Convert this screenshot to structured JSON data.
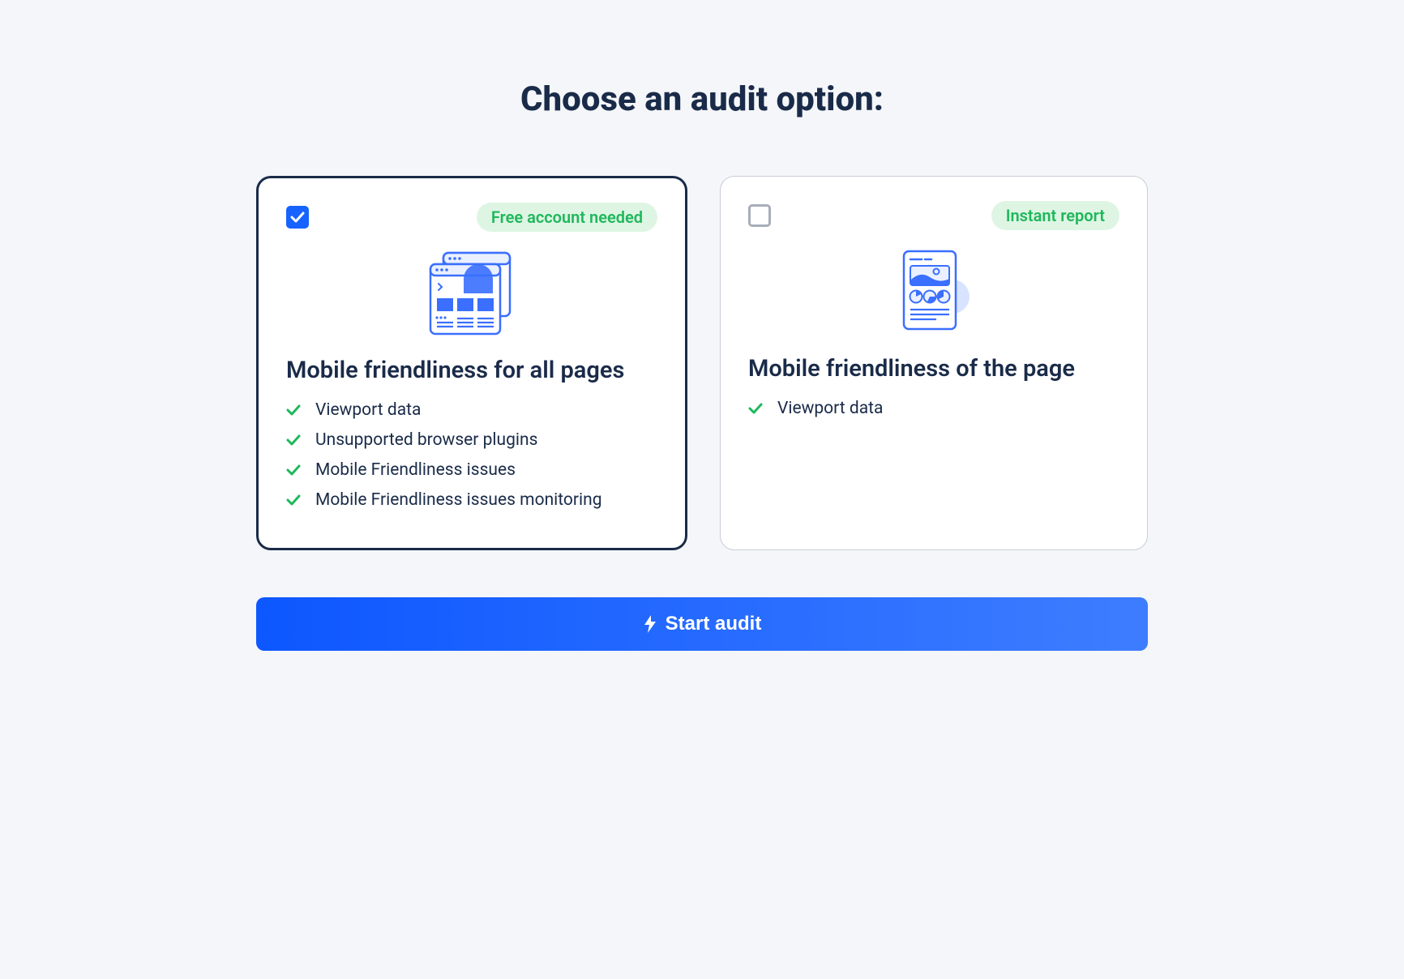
{
  "heading": "Choose an audit option:",
  "options": {
    "left": {
      "selected": true,
      "badge": "Free account needed",
      "title": "Mobile friendliness for all pages",
      "features": [
        "Viewport data",
        "Unsupported browser plugins",
        "Mobile Friendliness issues",
        "Mobile Friendliness issues monitoring"
      ]
    },
    "right": {
      "selected": false,
      "badge": "Instant report",
      "title": "Mobile friendliness of the page",
      "features": [
        "Viewport data"
      ]
    }
  },
  "cta": "Start audit"
}
